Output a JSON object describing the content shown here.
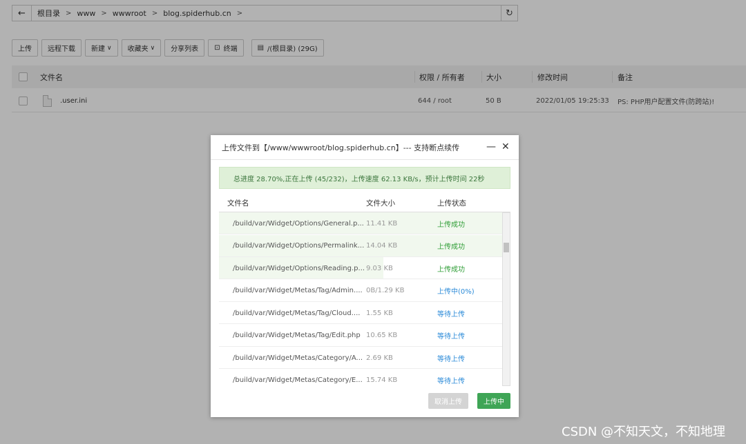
{
  "pathbar": {
    "back_icon": "arrow-left-icon",
    "crumbs": [
      "根目录",
      "www",
      "wwwroot",
      "blog.spiderhub.cn"
    ],
    "separator": ">",
    "refresh_icon": "refresh-icon"
  },
  "toolbar": {
    "upload": "上传",
    "remote_download": "远程下载",
    "new": "新建",
    "favorites": "收藏夹",
    "share_list": "分享列表",
    "terminal": "终端",
    "disk": "/(根目录) (29G)"
  },
  "file_table": {
    "headers": {
      "name": "文件名",
      "perm": "权限 / 所有者",
      "size": "大小",
      "mtime": "修改时间",
      "note": "备注"
    },
    "rows": [
      {
        "name": ".user.ini",
        "perm": "644 / root",
        "size": "50 B",
        "mtime": "2022/01/05 19:25:33",
        "note": "PS: PHP用户配置文件(防跨站)!"
      }
    ]
  },
  "dialog": {
    "title": "上传文件到【/www/wwwroot/blog.spiderhub.cn】--- 支持断点续传",
    "minimize_icon": "minimize-icon",
    "close_icon": "close-icon",
    "progress_text": "总进度 28.70%,正在上传 (45/232)，上传速度 62.13 KB/s，预计上传时间 22秒",
    "headers": {
      "name": "文件名",
      "size": "文件大小",
      "status": "上传状态"
    },
    "rows": [
      {
        "name": "/build/var/Widget/Options/General.p...",
        "size": "11.41 KB",
        "status": "上传成功",
        "kind": "done",
        "fill": 1.0
      },
      {
        "name": "/build/var/Widget/Options/Permalink...",
        "size": "14.04 KB",
        "status": "上传成功",
        "kind": "done",
        "fill": 1.0
      },
      {
        "name": "/build/var/Widget/Options/Reading.p...",
        "size": "9.03 KB",
        "status": "上传成功",
        "kind": "done",
        "fill": 0.58
      },
      {
        "name": "/build/var/Widget/Metas/Tag/Admin....",
        "size": "0B/1.29 KB",
        "status": "上传中(0%)",
        "kind": "up",
        "fill": 0
      },
      {
        "name": "/build/var/Widget/Metas/Tag/Cloud....",
        "size": "1.55 KB",
        "status": "等待上传",
        "kind": "wait",
        "fill": 0
      },
      {
        "name": "/build/var/Widget/Metas/Tag/Edit.php",
        "size": "10.65 KB",
        "status": "等待上传",
        "kind": "wait",
        "fill": 0
      },
      {
        "name": "/build/var/Widget/Metas/Category/A...",
        "size": "2.69 KB",
        "status": "等待上传",
        "kind": "wait",
        "fill": 0
      },
      {
        "name": "/build/var/Widget/Metas/Category/E...",
        "size": "15.74 KB",
        "status": "等待上传",
        "kind": "wait",
        "fill": 0
      }
    ],
    "cancel_label": "取消上传",
    "upload_label": "上传中"
  },
  "watermark": "CSDN @不知天文，不知地理"
}
